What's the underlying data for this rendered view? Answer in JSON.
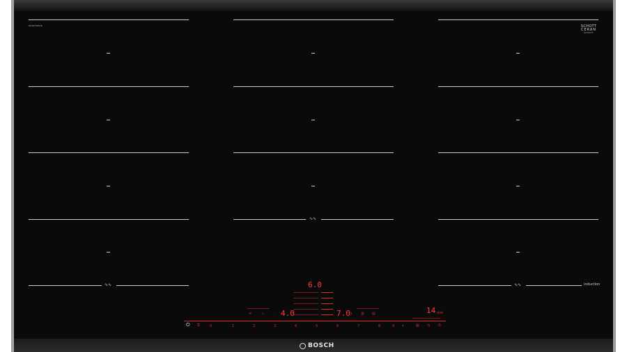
{
  "hob": {
    "model_label": "PXX875D57E",
    "brand_top": "SCHOTT",
    "brand_bottom": "CERAN",
    "brand_sub": "SCHOTT",
    "induction_label": "induction",
    "logo_text": "BOSCH",
    "zone_marker": "–",
    "wave_mark": "∿∿"
  },
  "display": {
    "power_top": "6.0",
    "power_left": "4.0",
    "power_right": "7.0",
    "timer": "14",
    "timer_unit": "min"
  },
  "controls": {
    "power_icon": "⏻",
    "slider_numbers": [
      "0",
      "1",
      "2",
      "3",
      "4",
      "5",
      "6",
      "7",
      "8",
      "9"
    ],
    "icons_left": [
      "≋",
      "∿"
    ],
    "icons_right": [
      "▥",
      "▤"
    ],
    "icons_end": [
      "▧",
      "◷",
      "⏱"
    ]
  },
  "colors": {
    "glass": "#0a0a0a",
    "accent_red": "#ff3b3b",
    "frame": "#cfcfcf"
  }
}
